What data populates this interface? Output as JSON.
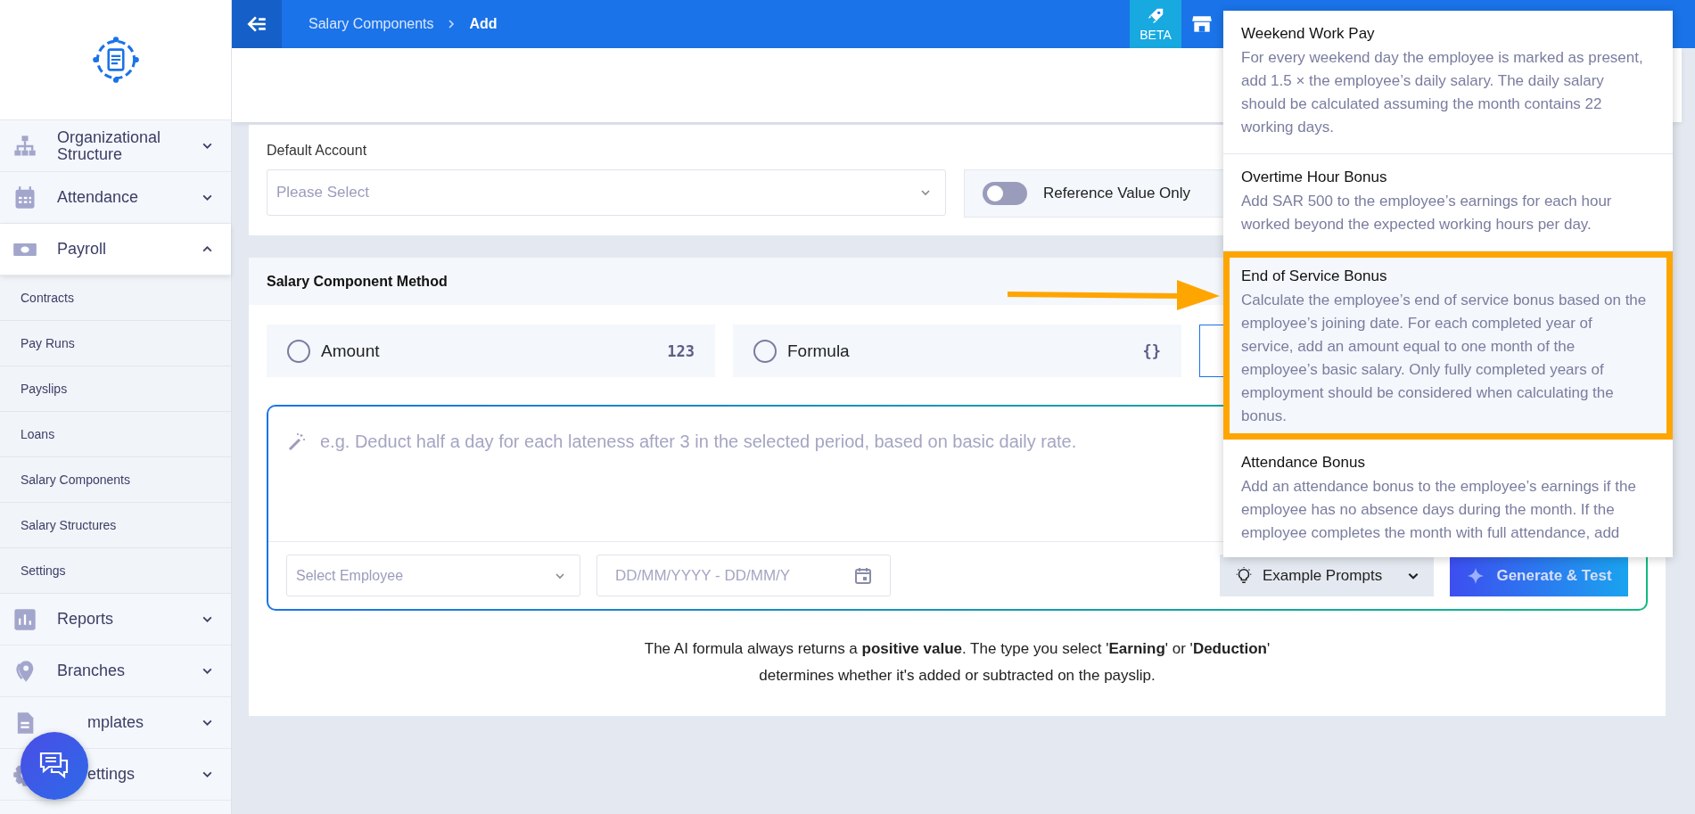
{
  "topbar": {
    "breadcrumb": [
      "Salary Components",
      "Add"
    ],
    "beta_label": "BETA"
  },
  "sidebar": {
    "items": [
      {
        "label": "Organizational Structure",
        "kind": "org",
        "expanded": false
      },
      {
        "label": "Attendance",
        "kind": "calendar",
        "expanded": false
      },
      {
        "label": "Payroll",
        "kind": "money",
        "expanded": true,
        "children": [
          {
            "label": "Contracts"
          },
          {
            "label": "Pay Runs"
          },
          {
            "label": "Payslips"
          },
          {
            "label": "Loans"
          },
          {
            "label": "Salary Components"
          },
          {
            "label": "Salary Structures"
          },
          {
            "label": "Settings"
          }
        ]
      },
      {
        "label": "Reports",
        "kind": "chart",
        "expanded": false
      },
      {
        "label": "Branches",
        "kind": "pin",
        "expanded": false
      },
      {
        "label": "mplates",
        "kind": "doc",
        "expanded": false
      },
      {
        "label": "ettings",
        "kind": "gear",
        "expanded": false
      }
    ]
  },
  "default_account": {
    "label": "Default Account",
    "placeholder": "Please Select"
  },
  "reference_toggle": {
    "label": "Reference Value Only",
    "on": false
  },
  "method": {
    "title": "Salary Component Method",
    "options": [
      {
        "label": "Amount",
        "badge": "123",
        "selected": false
      },
      {
        "label": "Formula",
        "badge": "{}",
        "selected": false
      },
      {
        "selected": true
      }
    ]
  },
  "ai": {
    "placeholder": "e.g. Deduct half a day for each lateness after 3 in the selected period, based on basic daily rate.",
    "employee_placeholder": "Select Employee",
    "date_placeholder": "DD/MM/YYYY - DD/MM/Y",
    "prompts_label": "Example Prompts",
    "generate_label": "Generate & Test",
    "note": "The AI formula always returns a **positive value**. The type you select '**Earning**' or '**Deduction**' determines whether it's added or subtracted on the payslip."
  },
  "prompts": [
    {
      "title": "Weekend Work Pay",
      "text": "For every weekend day the employee is marked as present, add 1.5 × the employee’s daily salary. The daily salary should be calculated assuming the month contains 22 working days.",
      "selected": false
    },
    {
      "title": "Overtime Hour Bonus",
      "text": "Add SAR 500 to the employee’s earnings for each hour worked beyond the expected working hours per day.",
      "selected": false
    },
    {
      "title": "End of Service Bonus",
      "text": "Calculate the employee’s end of service bonus based on the employee’s joining date. For each completed year of service, add an amount equal to one month of the employee’s basic salary. Only fully completed years of employment should be considered when calculating the bonus.",
      "selected": true
    },
    {
      "title": "Attendance Bonus",
      "text": "Add an attendance bonus to the employee’s earnings if the employee has no absence days during the month. If the employee completes the month with full attendance, add",
      "selected": false
    }
  ]
}
